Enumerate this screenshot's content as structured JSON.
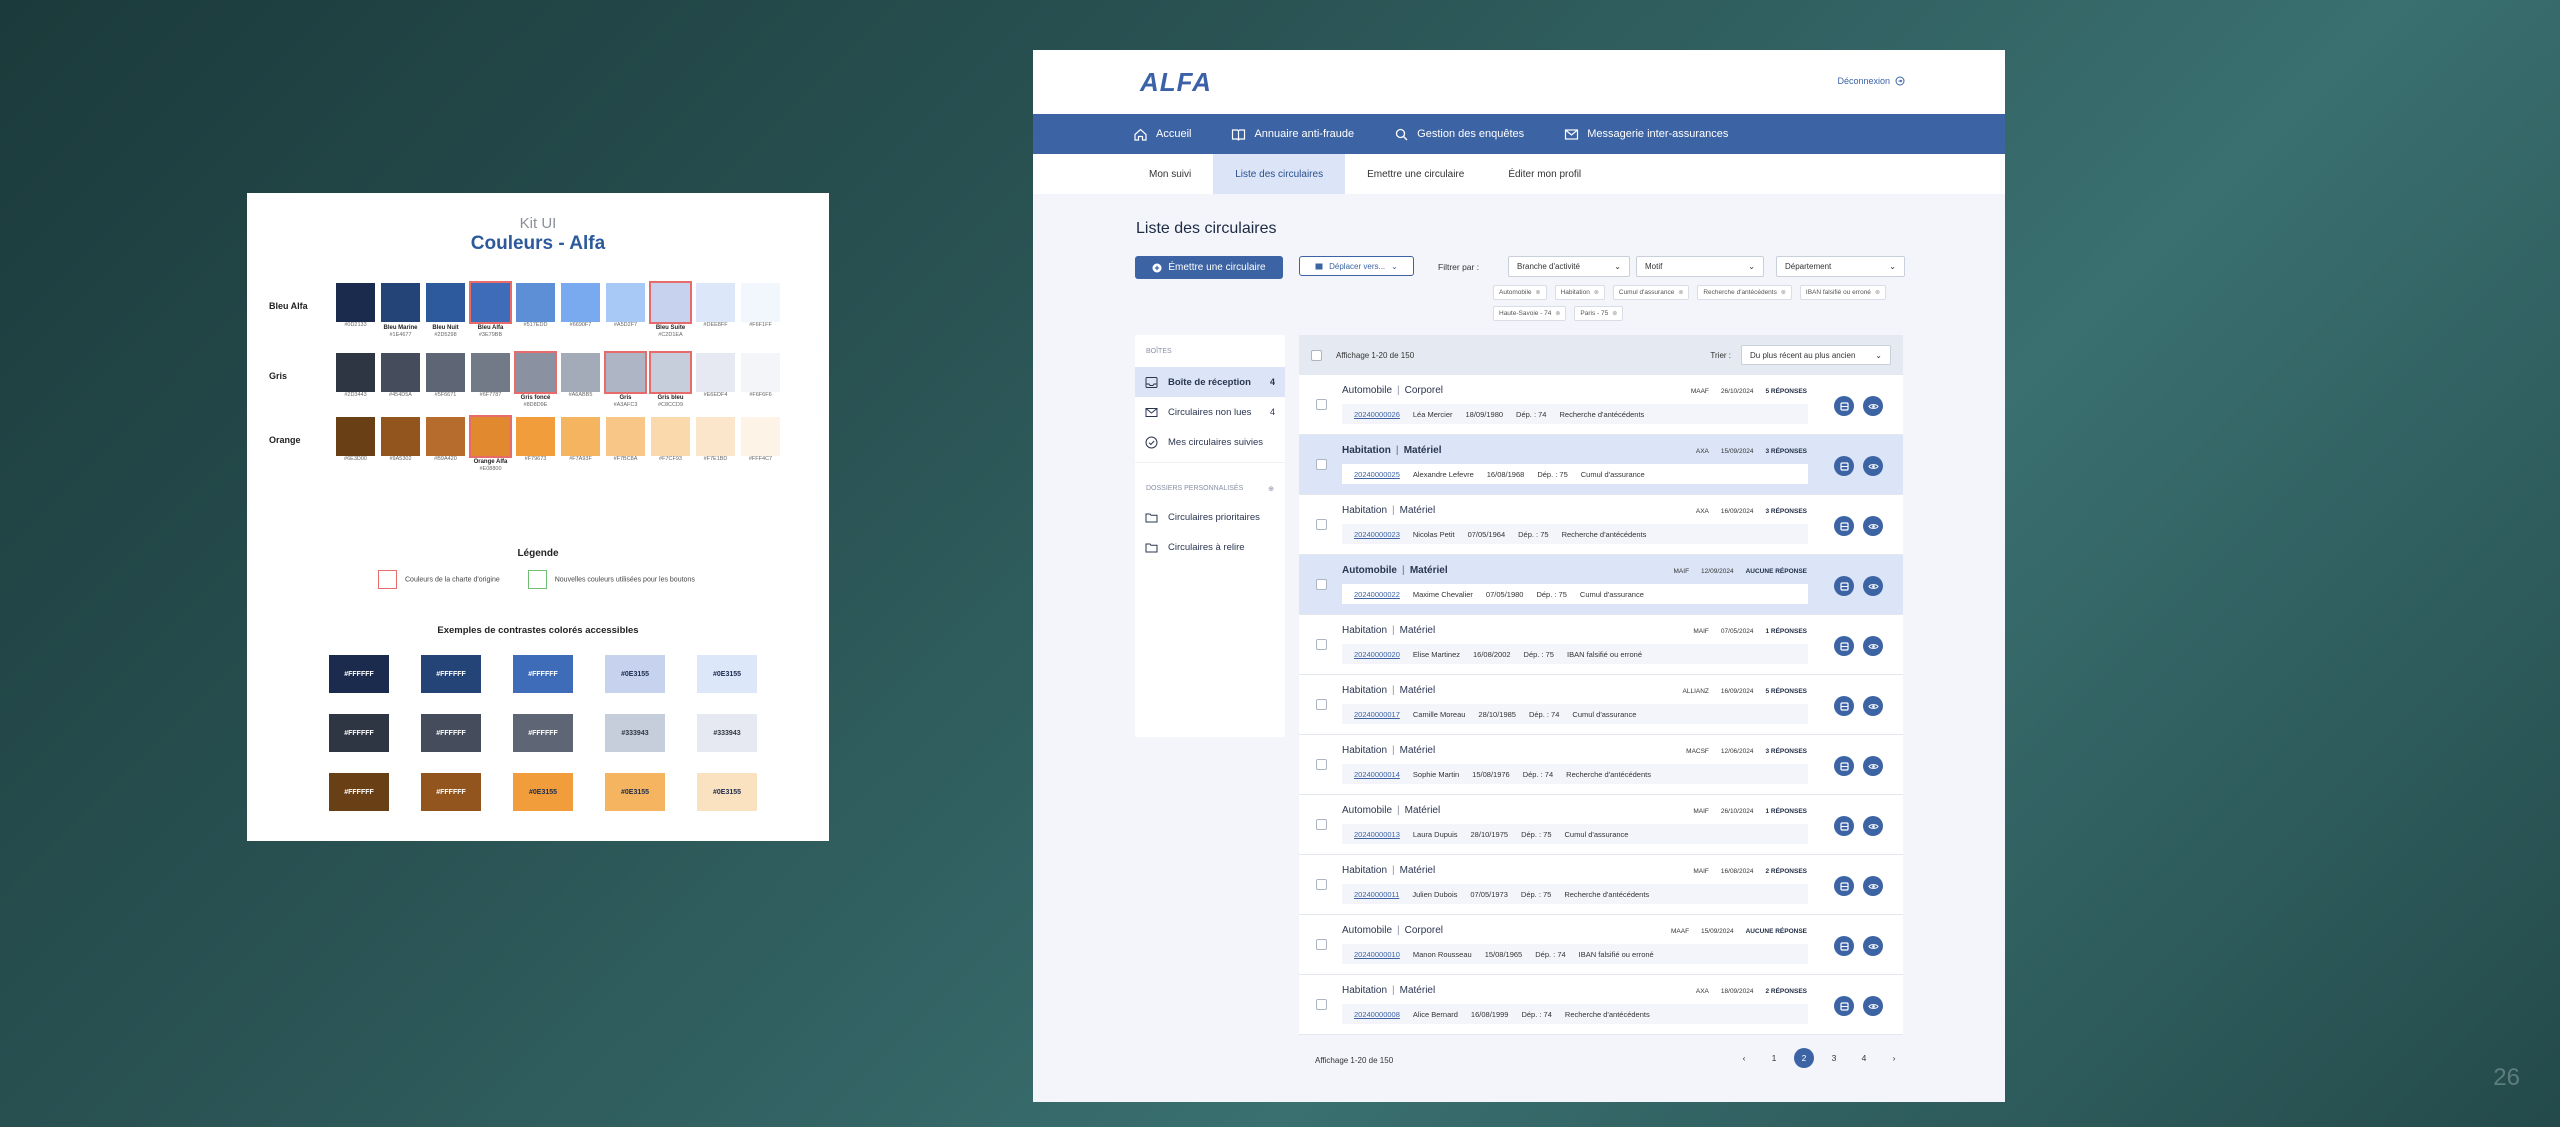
{
  "kit": {
    "title": "Kit UI",
    "subtitle": "Couleurs - Alfa",
    "rows": [
      {
        "label": "Bleu Alfa",
        "swatches": [
          {
            "color": "#1B2B4D",
            "name": "",
            "hex": "#0D2133"
          },
          {
            "color": "#244478",
            "name": "Bleu Marine",
            "hex": "#1E4677"
          },
          {
            "color": "#2C5A9C",
            "name": "Bleu Nuit",
            "hex": "#2D5298"
          },
          {
            "color": "#3E6CB8",
            "name": "Bleu Alfa",
            "hex": "#3E79BB",
            "hl": true
          },
          {
            "color": "#5D8FD6",
            "name": "",
            "hex": "#517EDD"
          },
          {
            "color": "#79AAF0",
            "name": "",
            "hex": "#6690F7"
          },
          {
            "color": "#A8C8F5",
            "name": "",
            "hex": "#A5D2F7"
          },
          {
            "color": "#C7D3EE",
            "name": "Bleu Suite",
            "hex": "#C2D1EA",
            "hl": true
          },
          {
            "color": "#DCE7FA",
            "name": "",
            "hex": "#DEE8FF"
          },
          {
            "color": "#F2F6FD",
            "name": "",
            "hex": "#F6F1FF"
          }
        ]
      },
      {
        "label": "Gris",
        "swatches": [
          {
            "color": "#2F3643",
            "name": "",
            "hex": "#2D3443"
          },
          {
            "color": "#454C5C",
            "name": "",
            "hex": "#454D5A"
          },
          {
            "color": "#5E6574",
            "name": "",
            "hex": "#5F6671"
          },
          {
            "color": "#737A87",
            "name": "",
            "hex": "#6F7787"
          },
          {
            "color": "#8A91A0",
            "name": "Gris foncé",
            "hex": "#8D8D9E",
            "hl": true
          },
          {
            "color": "#A3AAB8",
            "name": "",
            "hex": "#A6ABB5"
          },
          {
            "color": "#AEB6C6",
            "name": "Gris",
            "hex": "#A3AFC3",
            "hl": true
          },
          {
            "color": "#C7CEDB",
            "name": "Gris bleu",
            "hex": "#C8CCD9",
            "hl": true
          },
          {
            "color": "#E6E9F1",
            "name": "",
            "hex": "#E6EDF4"
          },
          {
            "color": "#F4F5F9",
            "name": "",
            "hex": "#F6F6F6"
          }
        ]
      },
      {
        "label": "Orange",
        "swatches": [
          {
            "color": "#693F15",
            "name": "",
            "hex": "#6E3D00"
          },
          {
            "color": "#92551E",
            "name": "",
            "hex": "#9A5302"
          },
          {
            "color": "#B56C2C",
            "name": "",
            "hex": "#B9A420"
          },
          {
            "color": "#E0892F",
            "name": "Orange Alfa",
            "hex": "#E08800",
            "hl": true
          },
          {
            "color": "#F29D3C",
            "name": "",
            "hex": "#F79673"
          },
          {
            "color": "#F5B560",
            "name": "",
            "hex": "#F7A93F"
          },
          {
            "color": "#F8C787",
            "name": "",
            "hex": "#F7BC8A"
          },
          {
            "color": "#FAD9AC",
            "name": "",
            "hex": "#F7CF93"
          },
          {
            "color": "#FCE6CB",
            "name": "",
            "hex": "#F7E1BD"
          },
          {
            "color": "#FDF3E6",
            "name": "",
            "hex": "#FFF4C7"
          }
        ]
      }
    ],
    "legend_title": "Légende",
    "legend_original": "Couleurs de la charte d'origine",
    "legend_new": "Nouvelles couleurs utilisées pour les boutons",
    "contrast_title": "Exemples de contrastes colorés accessibles",
    "contrast": [
      {
        "bg": "#1B2B4D",
        "fg": "#FFFFFF",
        "label": "#FFFFFF"
      },
      {
        "bg": "#244478",
        "fg": "#FFFFFF",
        "label": "#FFFFFF"
      },
      {
        "bg": "#3E6CB8",
        "fg": "#FFFFFF",
        "label": "#FFFFFF"
      },
      {
        "bg": "#C7D3EE",
        "fg": "#1B2B4D",
        "label": "#0E3155"
      },
      {
        "bg": "#DCE7FA",
        "fg": "#1B2B4D",
        "label": "#0E3155"
      },
      {
        "bg": "#2F3643",
        "fg": "#FFFFFF",
        "label": "#FFFFFF"
      },
      {
        "bg": "#454C5C",
        "fg": "#FFFFFF",
        "label": "#FFFFFF"
      },
      {
        "bg": "#5E6574",
        "fg": "#FFFFFF",
        "label": "#FFFFFF"
      },
      {
        "bg": "#C7CEDB",
        "fg": "#2F3643",
        "label": "#333943"
      },
      {
        "bg": "#E6E9F1",
        "fg": "#2F3643",
        "label": "#333943"
      },
      {
        "bg": "#693F15",
        "fg": "#FFFFFF",
        "label": "#FFFFFF"
      },
      {
        "bg": "#92551E",
        "fg": "#FFFFFF",
        "label": "#FFFFFF"
      },
      {
        "bg": "#F29D3C",
        "fg": "#1B2B4D",
        "label": "#0E3155"
      },
      {
        "bg": "#F5B560",
        "fg": "#1B2B4D",
        "label": "#0E3155"
      },
      {
        "bg": "#FAE1C0",
        "fg": "#1B2B4D",
        "label": "#0E3155"
      }
    ]
  },
  "app": {
    "logo": "ALFA",
    "logout": "Déconnexion",
    "nav": [
      {
        "label": "Accueil",
        "icon": "home-icon"
      },
      {
        "label": "Annuaire anti-fraude",
        "icon": "book-icon"
      },
      {
        "label": "Gestion des enquêtes",
        "icon": "search-icon"
      },
      {
        "label": "Messagerie inter-assurances",
        "icon": "mail-icon"
      }
    ],
    "subnav": [
      "Mon suivi",
      "Liste des circulaires",
      "Emettre une circulaire",
      "Éditer mon profil"
    ],
    "page_title": "Liste des circulaires",
    "emit_button": "Émettre une circulaire",
    "move_button": "Déplacer vers...",
    "filter_label": "Filtrer par :",
    "filters": [
      "Branche d'activité",
      "Motif",
      "Département"
    ],
    "chips": [
      "Automobile",
      "Habitation",
      "Cumul d'assurance",
      "Recherche d'antécédents",
      "IBAN falsifié ou erroné",
      "Haute-Savoie - 74",
      "Paris - 75"
    ],
    "sidebar": {
      "boxes_title": "BOÎTES",
      "items": [
        {
          "label": "Boîte de réception",
          "count": "4"
        },
        {
          "label": "Circulaires non lues",
          "count": "4"
        },
        {
          "label": "Mes circulaires suivies",
          "count": ""
        }
      ],
      "folders_title": "DOSSIERS PERSONNALISÉS",
      "folders": [
        "Circulaires prioritaires",
        "Circulaires à relire"
      ]
    },
    "list": {
      "count_label": "Affichage 1-20 de 150",
      "sort_label": "Trier :",
      "sort_value": "Du plus récent au plus ancien",
      "items": [
        {
          "branch": "Automobile",
          "type": "Corporel",
          "insurer": "MAAF",
          "date": "26/10/2024",
          "replies": "5 RÉPONSES",
          "ref": "20240000026",
          "name": "Léa Mercier",
          "birth": "18/09/1980",
          "dep": "Dép. : 74",
          "motif": "Recherche d'antécédents",
          "hi": false,
          "bold": false
        },
        {
          "branch": "Habitation",
          "type": "Matériel",
          "insurer": "AXA",
          "date": "15/09/2024",
          "replies": "3 RÉPONSES",
          "ref": "20240000025",
          "name": "Alexandre Lefevre",
          "birth": "16/08/1968",
          "dep": "Dép. : 75",
          "motif": "Cumul d'assurance",
          "hi": true,
          "bold": true
        },
        {
          "branch": "Habitation",
          "type": "Matériel",
          "insurer": "AXA",
          "date": "16/09/2024",
          "replies": "3 RÉPONSES",
          "ref": "20240000023",
          "name": "Nicolas Petit",
          "birth": "07/05/1964",
          "dep": "Dép. : 75",
          "motif": "Recherche d'antécédents",
          "hi": false,
          "bold": false
        },
        {
          "branch": "Automobile",
          "type": "Matériel",
          "insurer": "MAIF",
          "date": "12/09/2024",
          "replies": "AUCUNE RÉPONSE",
          "ref": "20240000022",
          "name": "Maxime Chevalier",
          "birth": "07/05/1980",
          "dep": "Dép. : 75",
          "motif": "Cumul d'assurance",
          "hi": true,
          "bold": true
        },
        {
          "branch": "Habitation",
          "type": "Matériel",
          "insurer": "MAIF",
          "date": "07/05/2024",
          "replies": "1 RÉPONSES",
          "ref": "20240000020",
          "name": "Elise Martinez",
          "birth": "16/08/2002",
          "dep": "Dép. : 75",
          "motif": "IBAN falsifié ou erroné",
          "hi": false,
          "bold": false
        },
        {
          "branch": "Habitation",
          "type": "Matériel",
          "insurer": "ALLIANZ",
          "date": "16/09/2024",
          "replies": "5 RÉPONSES",
          "ref": "20240000017",
          "name": "Camille Moreau",
          "birth": "28/10/1985",
          "dep": "Dép. : 74",
          "motif": "Cumul d'assurance",
          "hi": false,
          "bold": false
        },
        {
          "branch": "Habitation",
          "type": "Matériel",
          "insurer": "MACSF",
          "date": "12/06/2024",
          "replies": "3 RÉPONSES",
          "ref": "20240000014",
          "name": "Sophie Martin",
          "birth": "15/08/1976",
          "dep": "Dép. : 74",
          "motif": "Recherche d'antécédents",
          "hi": false,
          "bold": false
        },
        {
          "branch": "Automobile",
          "type": "Matériel",
          "insurer": "MAIF",
          "date": "26/10/2024",
          "replies": "1 RÉPONSES",
          "ref": "20240000013",
          "name": "Laura Dupuis",
          "birth": "28/10/1975",
          "dep": "Dép. : 75",
          "motif": "Cumul d'assurance",
          "hi": false,
          "bold": false
        },
        {
          "branch": "Habitation",
          "type": "Matériel",
          "insurer": "MAIF",
          "date": "16/08/2024",
          "replies": "2 RÉPONSES",
          "ref": "20240000011",
          "name": "Julien Dubois",
          "birth": "07/05/1973",
          "dep": "Dép. : 75",
          "motif": "Recherche d'antécédents",
          "hi": false,
          "bold": false
        },
        {
          "branch": "Automobile",
          "type": "Corporel",
          "insurer": "MAAF",
          "date": "15/09/2024",
          "replies": "AUCUNE RÉPONSE",
          "ref": "20240000010",
          "name": "Manon Rousseau",
          "birth": "15/08/1965",
          "dep": "Dép. : 74",
          "motif": "IBAN falsifié ou erroné",
          "hi": false,
          "bold": false
        },
        {
          "branch": "Habitation",
          "type": "Matériel",
          "insurer": "AXA",
          "date": "18/09/2024",
          "replies": "2 RÉPONSES",
          "ref": "20240000008",
          "name": "Alice Bernard",
          "birth": "16/08/1999",
          "dep": "Dép. : 74",
          "motif": "Recherche d'antécédents",
          "hi": false,
          "bold": false
        }
      ]
    },
    "footer_count": "Affichage 1-20 de 150",
    "pages": [
      "1",
      "2",
      "3",
      "4"
    ],
    "current_page": "2"
  },
  "slide_number": "26"
}
